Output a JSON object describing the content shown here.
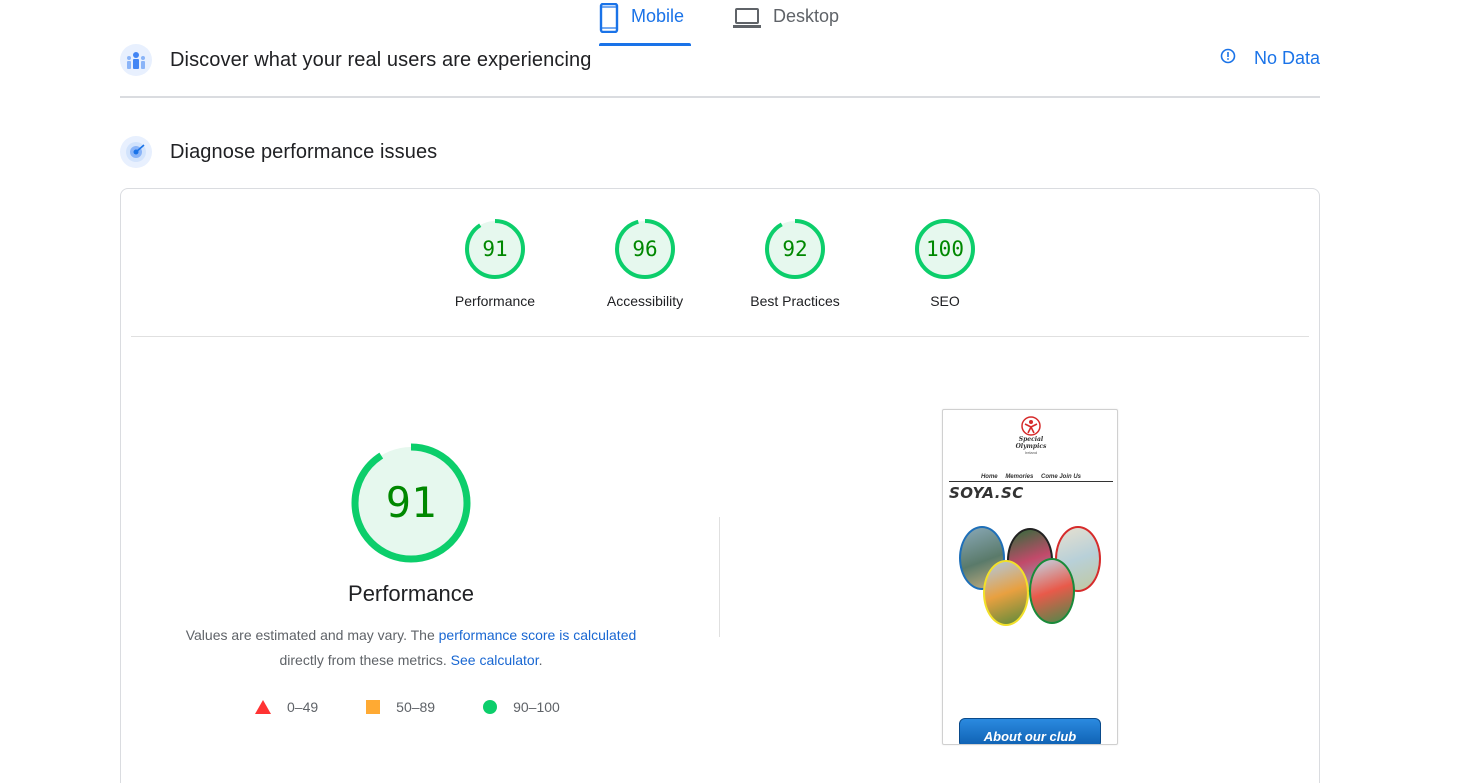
{
  "tabs": [
    {
      "label": "Mobile",
      "active": true,
      "icon": "smartphone-icon"
    },
    {
      "label": "Desktop",
      "active": false,
      "icon": "laptop-icon"
    }
  ],
  "real_users": {
    "title": "Discover what your real users are experiencing",
    "status_label": "No Data",
    "icon": "crux-users-icon"
  },
  "diagnose": {
    "title": "Diagnose performance issues",
    "icon": "lighthouse-icon"
  },
  "categories": [
    {
      "label": "Performance",
      "score": "91",
      "fraction": 0.91
    },
    {
      "label": "Accessibility",
      "score": "96",
      "fraction": 0.96
    },
    {
      "label": "Best Practices",
      "score": "92",
      "fraction": 0.92
    },
    {
      "label": "SEO",
      "score": "100",
      "fraction": 1.0
    }
  ],
  "performance": {
    "score": "91",
    "fraction": 0.91,
    "title": "Performance",
    "desc_prefix": "Values are estimated and may vary. The ",
    "desc_link1": "performance score is calculated",
    "desc_middle": " directly from these metrics. ",
    "desc_link2": "See calculator",
    "desc_suffix": "."
  },
  "legend": [
    {
      "range": "0–49",
      "shape": "triangle",
      "color": "#ff3333"
    },
    {
      "range": "50–89",
      "shape": "square",
      "color": "#ffaa33"
    },
    {
      "range": "90–100",
      "shape": "circle",
      "color": "#0cce6b"
    }
  ],
  "screenshot": {
    "logo_line1": "Special",
    "logo_line2": "Olympics",
    "logo_line3": "Ireland",
    "nav": [
      "Home",
      "Memories",
      "Come Join Us"
    ],
    "brand": "SOYA.SC",
    "button": "About our club"
  },
  "colors": {
    "accent": "#1a73e8",
    "pass": "#0cce6b",
    "pass_text": "#008800",
    "pass_bg": "#e6f8ee"
  }
}
